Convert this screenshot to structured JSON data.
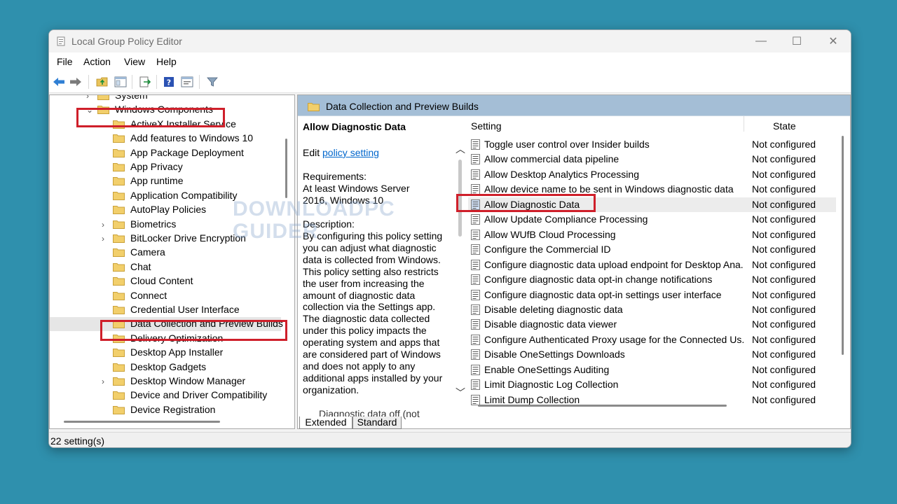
{
  "window": {
    "title": "Local Group Policy Editor",
    "controls": {
      "minimize": "—",
      "maximize": "☐",
      "close": "✕"
    }
  },
  "menu": [
    "File",
    "Action",
    "View",
    "Help"
  ],
  "toolbar_icons": [
    "back-arrow-icon",
    "forward-arrow-icon",
    "up-folder-icon",
    "show-hide-tree-icon",
    "export-list-icon",
    "help-icon",
    "properties-icon",
    "filter-icon"
  ],
  "tree": {
    "items": [
      {
        "label": "System",
        "expander": ">"
      },
      {
        "label": "Windows Components",
        "expander": "v"
      },
      {
        "label": "ActiveX Installer Service",
        "expander": ""
      },
      {
        "label": "Add features to Windows 10",
        "expander": ""
      },
      {
        "label": "App Package Deployment",
        "expander": ""
      },
      {
        "label": "App Privacy",
        "expander": ""
      },
      {
        "label": "App runtime",
        "expander": ""
      },
      {
        "label": "Application Compatibility",
        "expander": ""
      },
      {
        "label": "AutoPlay Policies",
        "expander": ""
      },
      {
        "label": "Biometrics",
        "expander": ">"
      },
      {
        "label": "BitLocker Drive Encryption",
        "expander": ">"
      },
      {
        "label": "Camera",
        "expander": ""
      },
      {
        "label": "Chat",
        "expander": ""
      },
      {
        "label": "Cloud Content",
        "expander": ""
      },
      {
        "label": "Connect",
        "expander": ""
      },
      {
        "label": "Credential User Interface",
        "expander": ""
      },
      {
        "label": "Data Collection and Preview Builds",
        "expander": ""
      },
      {
        "label": "Delivery Optimization",
        "expander": ""
      },
      {
        "label": "Desktop App Installer",
        "expander": ""
      },
      {
        "label": "Desktop Gadgets",
        "expander": ""
      },
      {
        "label": "Desktop Window Manager",
        "expander": ">"
      },
      {
        "label": "Device and Driver Compatibility",
        "expander": ""
      },
      {
        "label": "Device Registration",
        "expander": ""
      }
    ]
  },
  "right_pane": {
    "header": "Data Collection and Preview Builds",
    "description": {
      "title": "Allow Diagnostic Data",
      "edit_prefix": "Edit ",
      "edit_link": "policy setting",
      "requirements_heading": "Requirements:",
      "requirements": "At least Windows Server 2016, Windows 10",
      "description_heading": "Description:",
      "body": "By configuring this policy setting you can adjust what diagnostic data is collected from Windows. This policy setting also restricts the user from increasing the amount of diagnostic data collection via the Settings app. The diagnostic data collected under this policy impacts the operating system and apps that are considered part of Windows and does not apply to any additional apps installed by your organization.",
      "cut_off": "Diagnostic data off (not"
    },
    "columns": {
      "setting": "Setting",
      "state": "State"
    },
    "settings": [
      {
        "name": "Toggle user control over Insider builds",
        "state": "Not configured"
      },
      {
        "name": "Allow commercial data pipeline",
        "state": "Not configured"
      },
      {
        "name": "Allow Desktop Analytics Processing",
        "state": "Not configured"
      },
      {
        "name": "Allow device name to be sent in Windows diagnostic data",
        "state": "Not configured"
      },
      {
        "name": "Allow Diagnostic Data",
        "state": "Not configured"
      },
      {
        "name": "Allow Update Compliance Processing",
        "state": "Not configured"
      },
      {
        "name": "Allow WUfB Cloud Processing",
        "state": "Not configured"
      },
      {
        "name": "Configure the Commercial ID",
        "state": "Not configured"
      },
      {
        "name": "Configure diagnostic data upload endpoint for Desktop Ana...",
        "state": "Not configured"
      },
      {
        "name": "Configure diagnostic data opt-in change notifications",
        "state": "Not configured"
      },
      {
        "name": "Configure diagnostic data opt-in settings user interface",
        "state": "Not configured"
      },
      {
        "name": "Disable deleting diagnostic data",
        "state": "Not configured"
      },
      {
        "name": "Disable diagnostic data viewer",
        "state": "Not configured"
      },
      {
        "name": "Configure Authenticated Proxy usage for the Connected Us...",
        "state": "Not configured"
      },
      {
        "name": "Disable OneSettings Downloads",
        "state": "Not configured"
      },
      {
        "name": "Enable OneSettings Auditing",
        "state": "Not configured"
      },
      {
        "name": "Limit Diagnostic Log Collection",
        "state": "Not configured"
      },
      {
        "name": "Limit Dump Collection",
        "state": "Not configured"
      }
    ]
  },
  "tabs": [
    "Extended",
    "Standard"
  ],
  "status": "22 setting(s)",
  "watermark": "DOWNLOADPC\nGUIDER",
  "colors": {
    "highlight": "#cf1f2a",
    "background": "#2f90ad",
    "header_band": "#a4bed6",
    "link": "#0066cc"
  }
}
